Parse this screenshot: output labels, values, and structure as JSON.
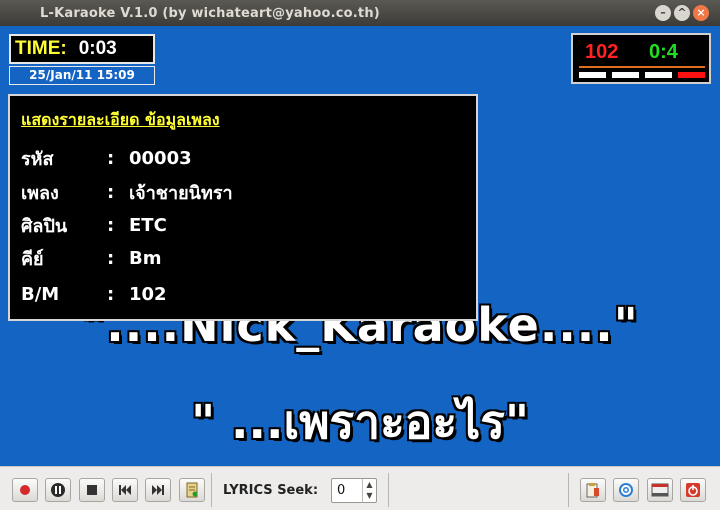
{
  "window": {
    "title": "L-Karaoke V.1.0 (by wichateart@yahoo.co.th)"
  },
  "clock": {
    "time_label": "TIME:",
    "time_value": "0:03",
    "date": "25/Jan/11 15:09"
  },
  "score": {
    "left": "102",
    "right": "0:4",
    "bars_total": 4,
    "bars_active": 1
  },
  "song_info": {
    "heading": "แสดงรายละเอียด ข้อมูลเพลง",
    "rows": [
      {
        "label": "รหัส",
        "colon": ":",
        "value": "00003"
      },
      {
        "label": "เพลง",
        "colon": ":",
        "value": "เจ้าชายนิทรา"
      },
      {
        "label": "ศิลปิน",
        "colon": ":",
        "value": "ETC"
      },
      {
        "label": "คีย์",
        "colon": ":",
        "value": "Bm"
      },
      {
        "label": "B/M",
        "colon": ":",
        "value": "102"
      }
    ]
  },
  "lyrics": {
    "line1": "\"....Nick_Karaoke....\"",
    "line2": "\" ...เพราะอะไร\""
  },
  "toolbar": {
    "seek_label": "LYRICS Seek:",
    "seek_value": "0"
  },
  "colors": {
    "stage_bg": "#1464c4",
    "time_label": "#ffff33",
    "score_left": "#ff2222",
    "score_right": "#22dd22"
  }
}
